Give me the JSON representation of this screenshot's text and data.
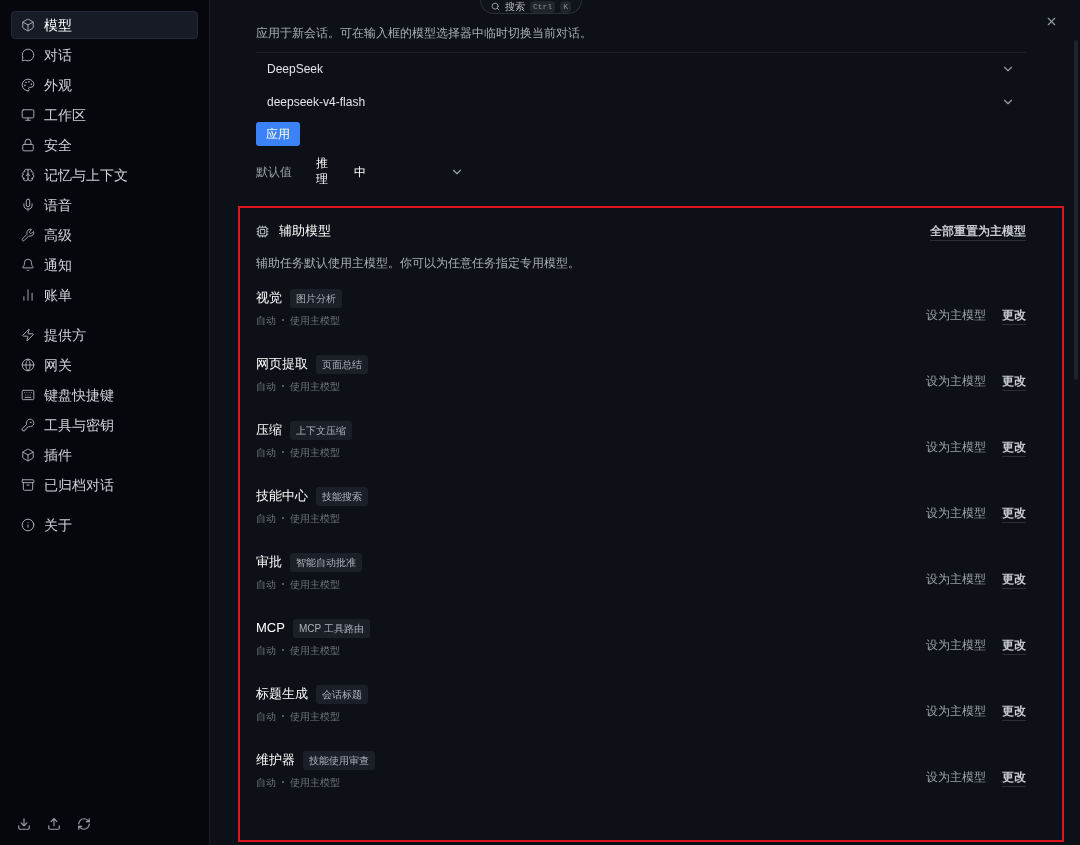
{
  "sidebar": {
    "groups": [
      {
        "items": [
          {
            "label": "模型",
            "selected": true
          },
          {
            "label": "对话",
            "selected": false
          },
          {
            "label": "外观",
            "selected": false
          },
          {
            "label": "工作区",
            "selected": false
          },
          {
            "label": "安全",
            "selected": false
          },
          {
            "label": "记忆与上下文",
            "selected": false
          },
          {
            "label": "语音",
            "selected": false
          },
          {
            "label": "高级",
            "selected": false
          },
          {
            "label": "通知",
            "selected": false
          },
          {
            "label": "账单",
            "selected": false
          }
        ]
      },
      {
        "items": [
          {
            "label": "提供方",
            "selected": false
          },
          {
            "label": "网关",
            "selected": false
          },
          {
            "label": "键盘快捷键",
            "selected": false
          },
          {
            "label": "工具与密钥",
            "selected": false
          },
          {
            "label": "插件",
            "selected": false
          },
          {
            "label": "已归档对话",
            "selected": false
          }
        ]
      },
      {
        "items": [
          {
            "label": "关于",
            "selected": false
          }
        ]
      }
    ]
  },
  "search": {
    "label": "搜索",
    "keys": [
      "Ctrl",
      "K"
    ]
  },
  "main_model": {
    "description": "应用于新会话。可在输入框的模型选择器中临时切换当前对话。",
    "provider": "DeepSeek",
    "model": "deepseek-v4-flash",
    "apply_button": "应用",
    "defaults_label": "默认值",
    "reasoning_label": "推理",
    "reasoning_value": "中"
  },
  "auxiliary": {
    "title": "辅助模型",
    "reset_all": "全部重置为主模型",
    "description": "辅助任务默认使用主模型。你可以为任意任务指定专用模型。",
    "tasks": [
      {
        "name": "视觉",
        "tag": "图片分析",
        "mode": "自动",
        "model": "使用主模型",
        "set_main": "设为主模型",
        "change": "更改"
      },
      {
        "name": "网页提取",
        "tag": "页面总结",
        "mode": "自动",
        "model": "使用主模型",
        "set_main": "设为主模型",
        "change": "更改"
      },
      {
        "name": "压缩",
        "tag": "上下文压缩",
        "mode": "自动",
        "model": "使用主模型",
        "set_main": "设为主模型",
        "change": "更改"
      },
      {
        "name": "技能中心",
        "tag": "技能搜索",
        "mode": "自动",
        "model": "使用主模型",
        "set_main": "设为主模型",
        "change": "更改"
      },
      {
        "name": "审批",
        "tag": "智能自动批准",
        "mode": "自动",
        "model": "使用主模型",
        "set_main": "设为主模型",
        "change": "更改"
      },
      {
        "name": "MCP",
        "tag": "MCP 工具路由",
        "mode": "自动",
        "model": "使用主模型",
        "set_main": "设为主模型",
        "change": "更改"
      },
      {
        "name": "标题生成",
        "tag": "会话标题",
        "mode": "自动",
        "model": "使用主模型",
        "set_main": "设为主模型",
        "change": "更改"
      },
      {
        "name": "维护器",
        "tag": "技能使用审查",
        "mode": "自动",
        "model": "使用主模型",
        "set_main": "设为主模型",
        "change": "更改"
      }
    ]
  }
}
